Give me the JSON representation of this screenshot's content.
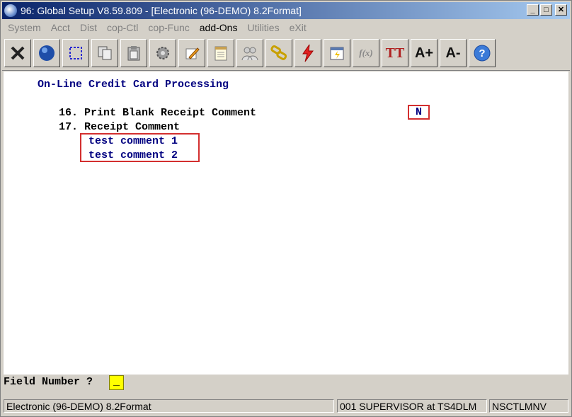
{
  "window": {
    "title": "96: Global Setup V8.59.809 - [Electronic (96-DEMO) 8.2Format]"
  },
  "menu": {
    "items": [
      {
        "label": "System",
        "enabled": false
      },
      {
        "label": "Acct",
        "enabled": false
      },
      {
        "label": "Dist",
        "enabled": false
      },
      {
        "label": "cop-Ctl",
        "enabled": false
      },
      {
        "label": "cop-Func",
        "enabled": false
      },
      {
        "label": "add-Ons",
        "enabled": true
      },
      {
        "label": "Utilities",
        "enabled": false
      },
      {
        "label": "eXit",
        "enabled": false
      }
    ]
  },
  "toolbar": {
    "icons": [
      "close-x-icon",
      "globe-icon",
      "select-box-icon",
      "copy-icon",
      "paste-icon",
      "settings-gear-icon",
      "edit-pencil-icon",
      "notepad-icon",
      "users-icon",
      "link-chain-icon",
      "lightning-icon",
      "calendar-icon",
      "function-icon",
      "text-tt-icon",
      "font-increase-icon",
      "font-decrease-icon",
      "help-icon"
    ],
    "glyphs": {
      "function": "f(x)",
      "tt": "TT",
      "font_up": "A+",
      "font_down": "A-",
      "help": "?"
    }
  },
  "screen": {
    "heading": "On-Line Credit Card Processing",
    "field16_label": "16. Print Blank Receipt Comment",
    "field16_value": "N",
    "field17_label": "17. Receipt Comment",
    "comment_line1": "test comment 1",
    "comment_line2": "test comment 2"
  },
  "prompt": {
    "label": "Field Number ?",
    "value": "_"
  },
  "status": {
    "panel1": "Electronic (96-DEMO) 8.2Format",
    "panel2": "001 SUPERVISOR at TS4DLM",
    "panel3": "NSCTLMNV"
  },
  "colors": {
    "heading": "#000080",
    "highlight_border": "#d32f2f",
    "prompt_input_bg": "#ffff00"
  }
}
